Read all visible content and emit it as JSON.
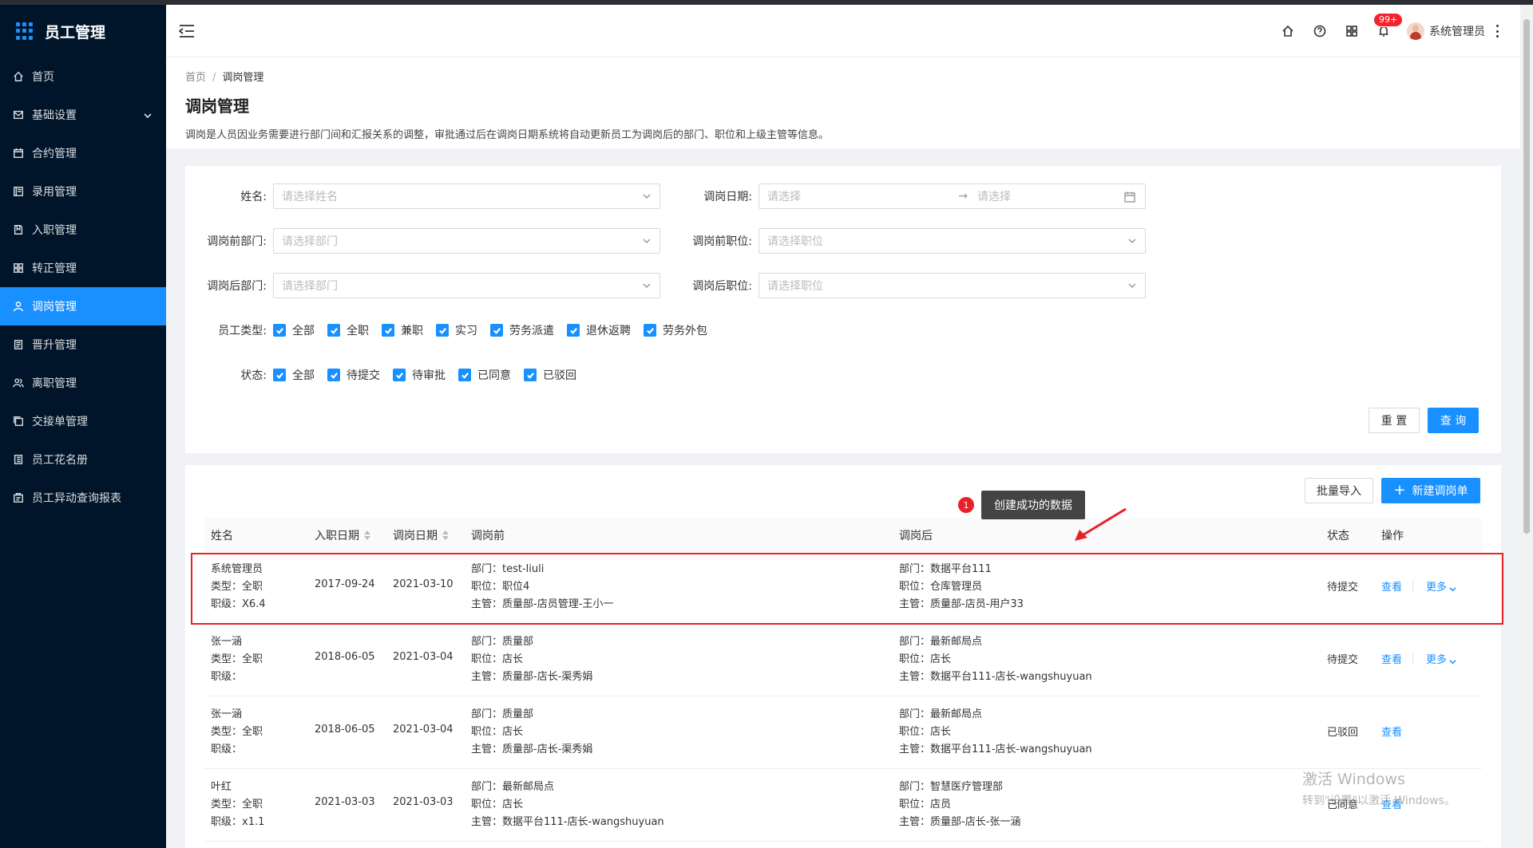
{
  "app": {
    "title": "员工管理"
  },
  "sidebar": {
    "items": [
      {
        "label": "首页",
        "icon": "home-icon"
      },
      {
        "label": "基础设置",
        "icon": "mail-icon",
        "has_submenu": true
      },
      {
        "label": "合约管理",
        "icon": "calendar-icon"
      },
      {
        "label": "录用管理",
        "icon": "book-icon"
      },
      {
        "label": "入职管理",
        "icon": "file-icon"
      },
      {
        "label": "转正管理",
        "icon": "grid-icon"
      },
      {
        "label": "调岗管理",
        "icon": "user-icon",
        "active": true
      },
      {
        "label": "晋升管理",
        "icon": "doc-icon"
      },
      {
        "label": "离职管理",
        "icon": "users-icon"
      },
      {
        "label": "交接单管理",
        "icon": "copy-icon"
      },
      {
        "label": "员工花名册",
        "icon": "list-icon"
      },
      {
        "label": "员工异动查询报表",
        "icon": "report-icon"
      }
    ]
  },
  "header": {
    "badge": "99+",
    "username": "系统管理员"
  },
  "breadcrumb": {
    "home": "首页",
    "current": "调岗管理"
  },
  "page": {
    "title": "调岗管理",
    "description": "调岗是人员因业务需要进行部门间和汇报关系的调整，审批通过后在调岗日期系统将自动更新员工为调岗后的部门、职位和上级主管等信息。"
  },
  "filters": {
    "name_label": "姓名:",
    "name_placeholder": "请选择姓名",
    "date_label": "调岗日期:",
    "date_start_placeholder": "请选择",
    "date_end_placeholder": "请选择",
    "before_dept_label": "调岗前部门:",
    "before_dept_placeholder": "请选择部门",
    "before_pos_label": "调岗前职位:",
    "before_pos_placeholder": "请选择职位",
    "after_dept_label": "调岗后部门:",
    "after_dept_placeholder": "请选择部门",
    "after_pos_label": "调岗后职位:",
    "after_pos_placeholder": "请选择职位",
    "type_label": "员工类型:",
    "types": [
      "全部",
      "全职",
      "兼职",
      "实习",
      "劳务派遣",
      "退休返聘",
      "劳务外包"
    ],
    "status_label": "状态:",
    "statuses": [
      "全部",
      "待提交",
      "待审批",
      "已同意",
      "已驳回"
    ],
    "reset": "重 置",
    "search": "查 询"
  },
  "toolbar": {
    "import": "批量导入",
    "new": "新建调岗单"
  },
  "annotation": {
    "number": "1",
    "text": "创建成功的数据"
  },
  "table": {
    "headers": {
      "name": "姓名",
      "hire_date": "入职日期",
      "transfer_date": "调岗日期",
      "before": "调岗前",
      "after": "调岗后",
      "status": "状态",
      "action": "操作"
    },
    "rows": [
      {
        "name": "系统管理员",
        "type": "类型：全职",
        "level": "职级：X6.4",
        "hire": "2017-09-24",
        "date": "2021-03-10",
        "before_dept": "部门：test-liuli",
        "before_pos": "职位：职位4",
        "before_mgr": "主管：质量部-店员管理-王小一",
        "after_dept": "部门：数据平台111",
        "after_pos": "职位：仓库管理员",
        "after_mgr": "主管：质量部-店员-用户33",
        "status": "待提交",
        "view": "查看",
        "more": "更多"
      },
      {
        "name": "张一涵",
        "type": "类型：全职",
        "level": "职级：",
        "hire": "2018-06-05",
        "date": "2021-03-04",
        "before_dept": "部门：质量部",
        "before_pos": "职位：店长",
        "before_mgr": "主管：质量部-店长-渠秀娟",
        "after_dept": "部门：最新邮局点",
        "after_pos": "职位：店长",
        "after_mgr": "主管：数据平台111-店长-wangshuyuan",
        "status": "待提交",
        "view": "查看",
        "more": "更多"
      },
      {
        "name": "张一涵",
        "type": "类型：全职",
        "level": "职级：",
        "hire": "2018-06-05",
        "date": "2021-03-04",
        "before_dept": "部门：质量部",
        "before_pos": "职位：店长",
        "before_mgr": "主管：质量部-店长-渠秀娟",
        "after_dept": "部门：最新邮局点",
        "after_pos": "职位：店长",
        "after_mgr": "主管：数据平台111-店长-wangshuyuan",
        "status": "已驳回",
        "view": "查看"
      },
      {
        "name": "叶红",
        "type": "类型：全职",
        "level": "职级：x1.1",
        "hire": "2021-03-03",
        "date": "2021-03-03",
        "before_dept": "部门：最新邮局点",
        "before_pos": "职位：店长",
        "before_mgr": "主管：数据平台111-店长-wangshuyuan",
        "after_dept": "部门：智慧医疗管理部",
        "after_pos": "职位：店员",
        "after_mgr": "主管：质量部-店长-张一涵",
        "status": "已同意",
        "view": "查看"
      }
    ]
  },
  "watermark": {
    "line1": "激活 Windows",
    "line2": "转到\"设置\"以激活 Windows。"
  },
  "colors": {
    "primary": "#1890ff",
    "sidebar": "#001529",
    "highlight": "#e8202a"
  }
}
